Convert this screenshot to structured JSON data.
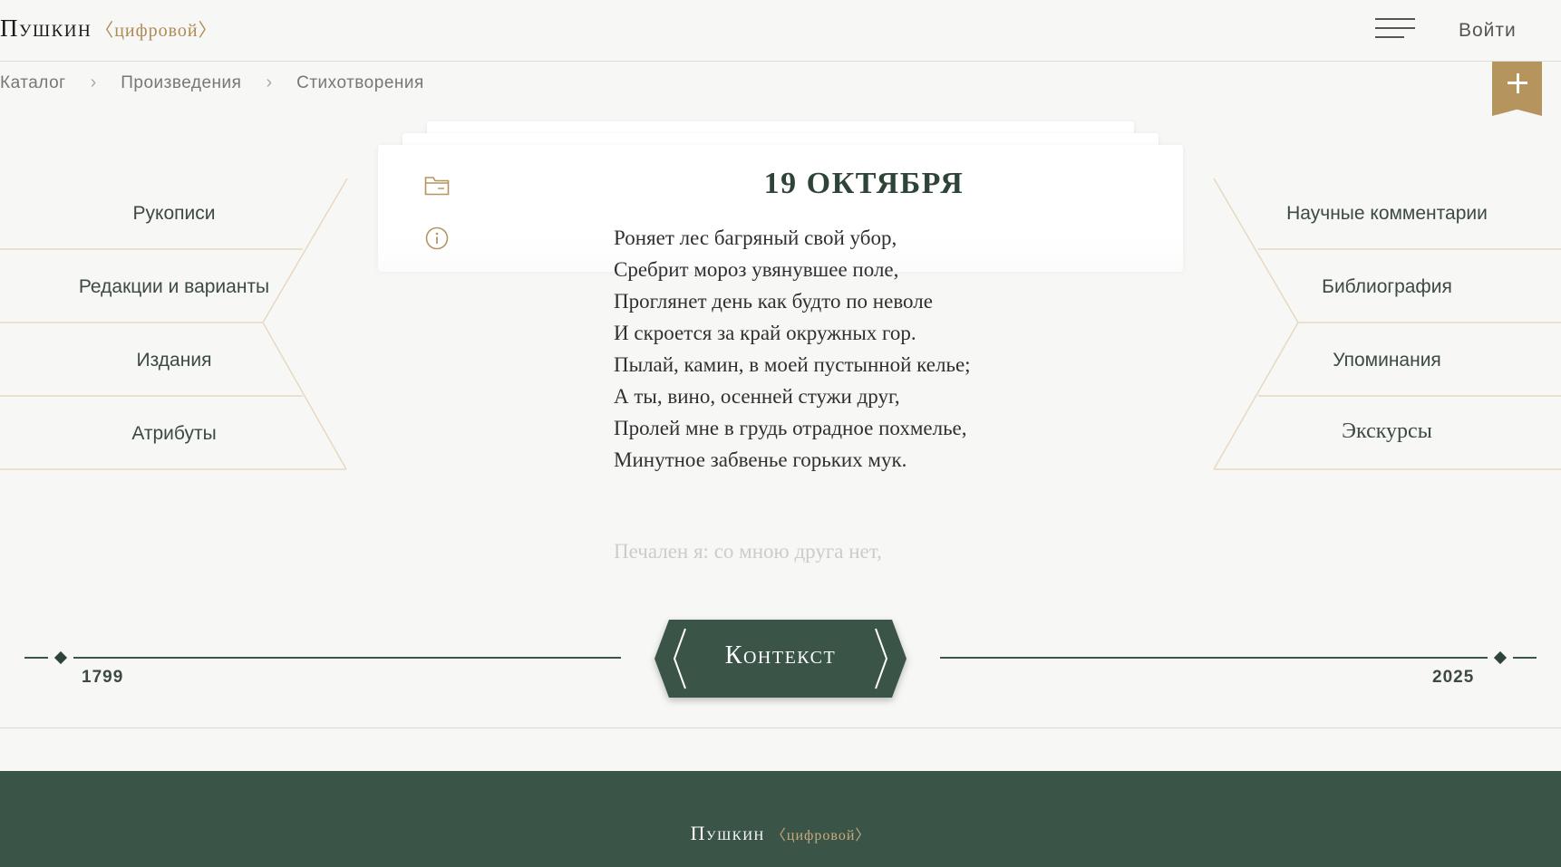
{
  "header": {
    "logo": "Пушкин",
    "logo_sub": "〈цифровой〉",
    "login": "Войти"
  },
  "breadcrumb": [
    "Каталог",
    "Произведения",
    "Стихотворения"
  ],
  "left_menu": [
    "Рукописи",
    "Редакции и варианты",
    "Издания",
    "Атрибуты"
  ],
  "right_menu": [
    "Научные комментарии",
    "Библиография",
    "Упоминания",
    "Экскурсы"
  ],
  "poem": {
    "title": "19 ОКТЯБРЯ",
    "lines": [
      "Роняет лес багряный свой убор,",
      "Сребрит мороз увянувшее поле,",
      "Проглянет день как будто по неволе",
      "И скроется за край окружных гор.",
      "Пылай, камин, в моей пустынной келье;",
      "А ты, вино, осенней стужи друг,",
      "Пролей мне в грудь отрадное похмелье,",
      "Минутное забвенье горьких мук."
    ],
    "next_line": "Печален я: со мною друга нет,"
  },
  "timeline": {
    "start_year": "1799",
    "end_year": "2025",
    "button": "Контекст"
  },
  "footer": {
    "logo": "Пушкин",
    "logo_sub": "〈цифровой〉"
  },
  "colors": {
    "accent_green": "#3b5448",
    "accent_gold": "#b5955d",
    "background": "#f7f7f6"
  },
  "icons": [
    "menu-icon",
    "chevron-right-icon",
    "plus-icon",
    "folder-icon",
    "info-icon"
  ]
}
